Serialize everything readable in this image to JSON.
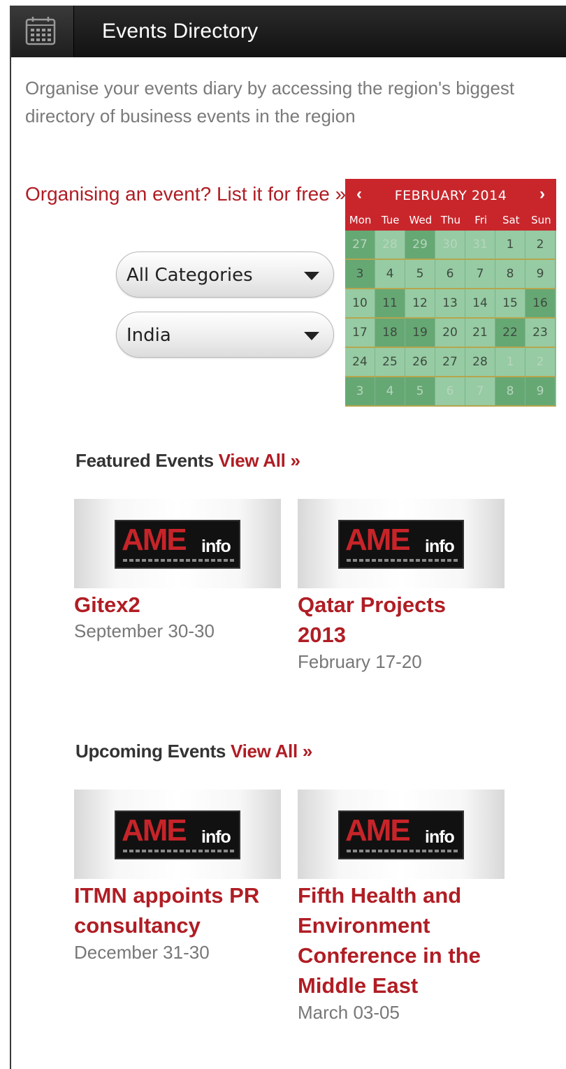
{
  "header": {
    "title": "Events Directory",
    "icon": "calendar-icon"
  },
  "intro": "Organise your events diary by accessing the region's biggest directory of business events in the region",
  "list_it_link": "Organising an event? List it for free »",
  "filters": {
    "category": "All Categories",
    "country": "India"
  },
  "calendar": {
    "prev": "‹",
    "next": "›",
    "month": "FEBRUARY 2014",
    "weekdays": [
      "Mon",
      "Tue",
      "Wed",
      "Thu",
      "Fri",
      "Sat",
      "Sun"
    ],
    "weeks": [
      [
        "27",
        "28",
        "29",
        "30",
        "31",
        "1",
        "2"
      ],
      [
        "3",
        "4",
        "5",
        "6",
        "7",
        "8",
        "9"
      ],
      [
        "10",
        "11",
        "12",
        "13",
        "14",
        "15",
        "16"
      ],
      [
        "17",
        "18",
        "19",
        "20",
        "21",
        "22",
        "23"
      ],
      [
        "24",
        "25",
        "26",
        "27",
        "28",
        "1",
        "2"
      ],
      [
        "3",
        "4",
        "5",
        "6",
        "7",
        "8",
        "9"
      ]
    ]
  },
  "featured": {
    "title": "Featured Events",
    "view_all": "View All »",
    "events": [
      {
        "logo": "AME",
        "logo_suffix": "info",
        "title": "Gitex2",
        "date": "September 30-30"
      },
      {
        "logo": "AME",
        "logo_suffix": "info",
        "title": "Qatar Projects 2013",
        "date": "February 17-20"
      }
    ]
  },
  "upcoming": {
    "title": "Upcoming Events",
    "view_all": "View All »",
    "events": [
      {
        "logo": "AME",
        "logo_suffix": "info",
        "title": "ITMN appoints PR consultancy",
        "date": "December 31-30"
      },
      {
        "logo": "AME",
        "logo_suffix": "info",
        "title": "Fifth Health and Environment Conference in the Middle East",
        "date": "March 03-05"
      }
    ]
  },
  "colors": {
    "accent": "#b01d24",
    "calendar_header": "#c9262c",
    "calendar_bg": "#8cc59a",
    "header_bg": "#1a1a1a"
  }
}
